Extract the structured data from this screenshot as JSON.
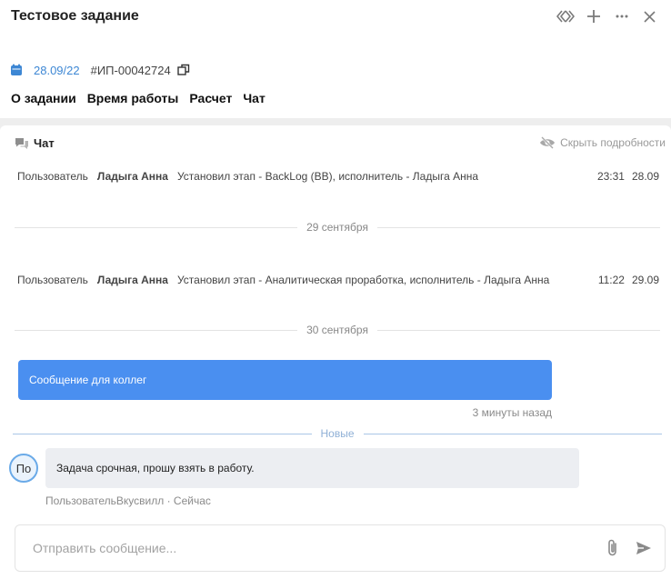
{
  "header": {
    "title": "Тестовое задание",
    "date": "28.09/22",
    "task_number": "#ИП-00042724"
  },
  "tabs": [
    {
      "label": "О задании"
    },
    {
      "label": "Время работы"
    },
    {
      "label": "Расчет"
    },
    {
      "label": "Чат"
    }
  ],
  "chat": {
    "title": "Чат",
    "hide_details": "Скрыть подробности",
    "events": [
      {
        "role": "Пользователь",
        "who": "Ладыга Анна",
        "what": "Установил этап - BackLog (BB), исполнитель - Ладыга Анна",
        "time": "23:31",
        "date": "28.09"
      },
      {
        "role": "Пользователь",
        "who": "Ладыга Анна",
        "what": "Установил этап - Аналитическая проработка, исполнитель - Ладыга Анна",
        "time": "11:22",
        "date": "29.09"
      }
    ],
    "dividers": [
      "29 сентября",
      "30 сентября"
    ],
    "my_message": {
      "text": "Сообщение для коллег",
      "time": "3 минуты назад"
    },
    "new_label": "Новые",
    "their_message": {
      "avatar": "По",
      "text": "Задача срочная, прошу взять в работу.",
      "author": "ПользовательВкусвилл",
      "separator": "·",
      "time": "Сейчас"
    },
    "composer_placeholder": "Отправить сообщение..."
  },
  "colors": {
    "accent": "#4a8ff0",
    "link": "#3d87d4",
    "incoming_bubble": "#eceef2",
    "new_divider": "#a9c6e6"
  },
  "icons": [
    "diamond-link-icon",
    "plus-icon",
    "more-icon",
    "close-icon",
    "calendar-icon",
    "copy-icon",
    "chat-bubbles-icon",
    "eye-off-icon",
    "paperclip-icon",
    "send-icon"
  ]
}
